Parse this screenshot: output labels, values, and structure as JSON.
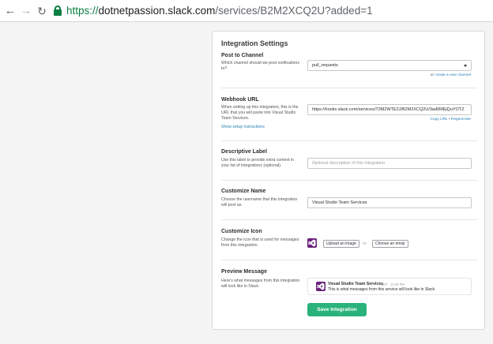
{
  "browser": {
    "back_icon": "arrow-left-icon",
    "forward_icon": "arrow-right-icon",
    "reload_icon": "reload-icon",
    "secure_icon": "lock-icon",
    "url_scheme": "https://",
    "url_host": "dotnetpassion.slack.com",
    "url_rest": "/services/B2M2XCQ2U?added=1"
  },
  "panel": {
    "title": "Integration Settings"
  },
  "post_to_channel": {
    "title": "Post to Channel",
    "description": "Which channel should we post notifications to?",
    "selected": "pull_requests",
    "create_prefix": "or",
    "create_link": "create a new channel"
  },
  "webhook": {
    "title": "Webhook URL",
    "description": "When setting up this integration, this is the URL that you will paste into Visual Studio Team Services.",
    "instructions_link": "Show setup instructions",
    "url_value": "https://hooks.slack.com/services/T2M2WTE2J/B2M2XCQ2U/3ad0MEjQuYOTZ",
    "copy_link": "Copy URL",
    "separator": "•",
    "regenerate_link": "Regenerate"
  },
  "descriptive_label": {
    "title": "Descriptive Label",
    "description": "Use this label to provide extra context in your list of integrations (optional).",
    "placeholder": "Optional description of this integration"
  },
  "customize_name": {
    "title": "Customize Name",
    "description": "Choose the username that this integration will post as.",
    "value": "Visual Studio Team Services"
  },
  "customize_icon": {
    "title": "Customize Icon",
    "description": "Change the icon that is used for messages from this integration.",
    "upload_label": "Upload an image",
    "or_label": "or",
    "emoji_label": "Choose an emoji"
  },
  "preview_message": {
    "title": "Preview Message",
    "description": "Here's what messages from this integration will look like in Slack.",
    "sender": "Visual Studio Team Services",
    "bot_tag": "BOT",
    "time": "12:26 PM",
    "text": "This is what messages from this service will look like in Slack."
  },
  "save_label": "Save Integration",
  "colors": {
    "accent_green": "#2ab27b",
    "link_blue": "#2a80b9",
    "vs_purple": "#68217a",
    "secure_green": "#0b8043"
  }
}
